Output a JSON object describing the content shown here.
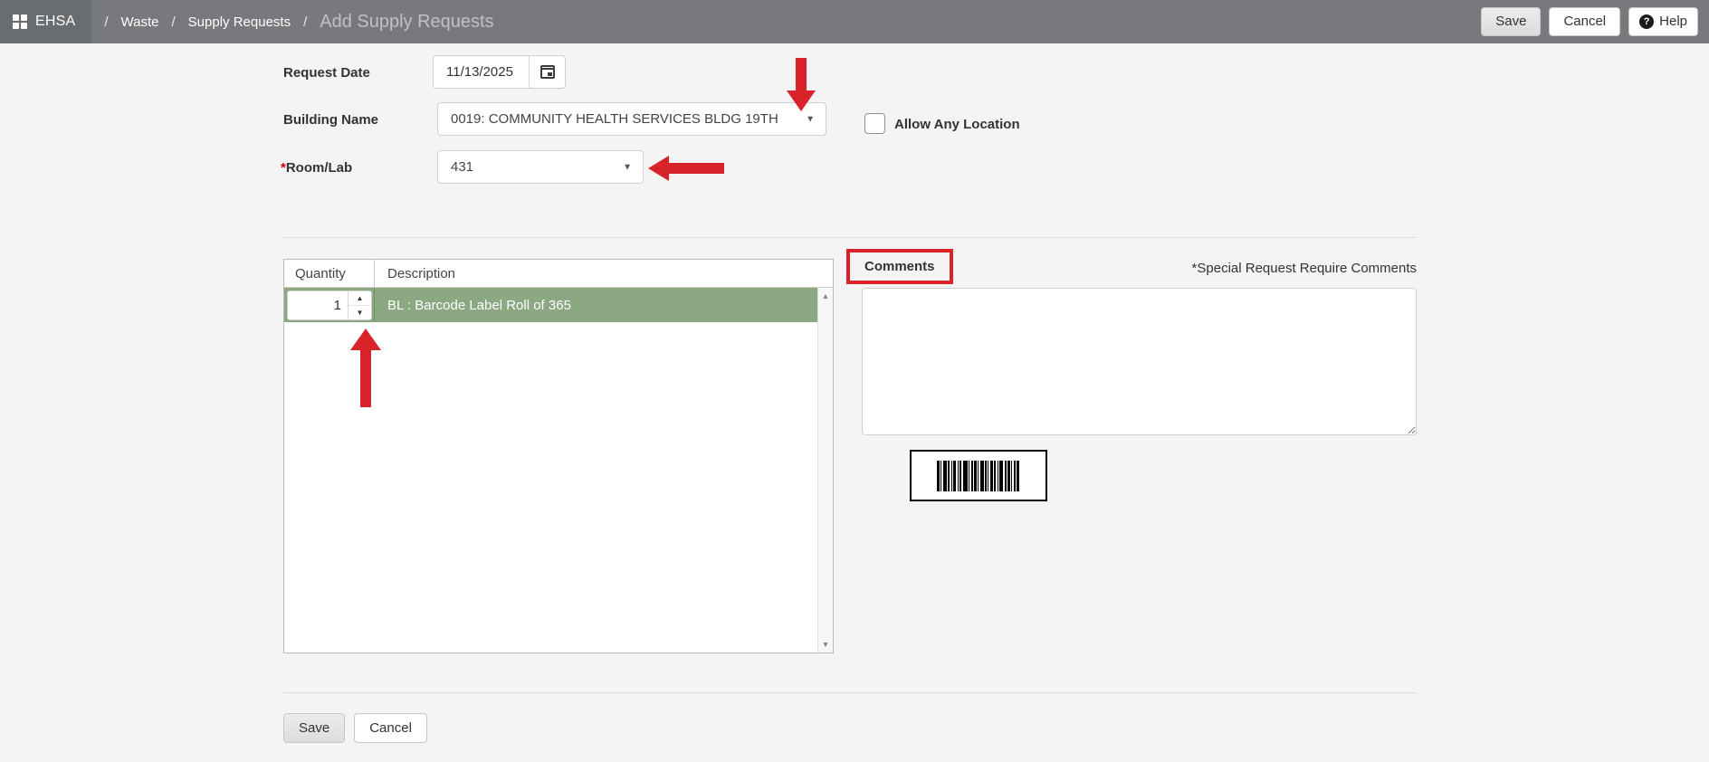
{
  "colors": {
    "header_bg": "#77797C",
    "header_tab_bg": "#6A6D70",
    "annotation_red": "#D9232A",
    "row_green": "#8BA882",
    "page_bg": "#F4F4F4"
  },
  "icons": {
    "grid": "grid",
    "help": "?",
    "calendar": "calendar",
    "dropdown_caret": "▼",
    "spin_up": "▲",
    "spin_down": "▼",
    "scroll_up": "▲",
    "scroll_down": "▼"
  },
  "header": {
    "app_name": "EHSA",
    "breadcrumb_separator": "/",
    "breadcrumb_items": [
      "Waste",
      "Supply Requests"
    ],
    "page_title": "Add Supply Requests",
    "save_label": "Save",
    "cancel_label": "Cancel",
    "help_label": "Help"
  },
  "form": {
    "request_date": {
      "label": "Request Date",
      "value": "11/13/2025"
    },
    "building_name": {
      "label": "Building Name",
      "value": "0019: COMMUNITY HEALTH SERVICES BLDG 19TH"
    },
    "allow_any_location": {
      "label": "Allow Any Location",
      "checked": false
    },
    "room_lab": {
      "required_mark": "*",
      "label": "Room/Lab",
      "value": "431"
    }
  },
  "supply_table": {
    "columns": [
      "Quantity",
      "Description"
    ],
    "rows": [
      {
        "quantity": "1",
        "description": "BL : Barcode Label Roll of 365"
      }
    ]
  },
  "comments": {
    "label": "Comments",
    "note": "*Special Request Require Comments",
    "value": ""
  },
  "barcode": {
    "bars": [
      3,
      1,
      1,
      2,
      4,
      1,
      2,
      2,
      1,
      1,
      3,
      2,
      1,
      1,
      2,
      2,
      5,
      1,
      1,
      2,
      2,
      1,
      3,
      1,
      1,
      2,
      4,
      1,
      2,
      1,
      1,
      2,
      3,
      1,
      2,
      2,
      1,
      1,
      4,
      2,
      2,
      1,
      3,
      1,
      1,
      2,
      2,
      1,
      3,
      2
    ]
  },
  "footer": {
    "save_label": "Save",
    "cancel_label": "Cancel"
  }
}
